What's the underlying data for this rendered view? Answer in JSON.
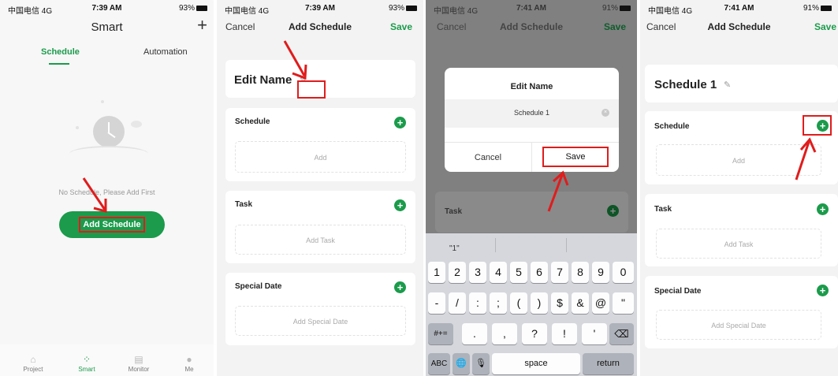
{
  "colors": {
    "brand_green": "#1b9b4b",
    "highlight_red": "#e01c1c"
  },
  "status_bar": {
    "carrier": "中国电信 4G",
    "screen1_time": "7:39 AM",
    "screen1_battery": "93%",
    "screen2_time": "7:39 AM",
    "screen2_battery": "93%",
    "screen3_time": "7:41 AM",
    "screen3_battery": "91%",
    "screen4_time": "7:41 AM",
    "screen4_battery": "91%"
  },
  "screen1": {
    "title": "Smart",
    "add_icon": "plus-icon",
    "tabs": [
      "Schedule",
      "Automation"
    ],
    "empty_message": "No Schedule, Please Add First",
    "add_button": "Add Schedule",
    "bottom_nav": [
      {
        "label": "Project",
        "icon": "home-icon"
      },
      {
        "label": "Smart",
        "icon": "smart-dots-icon"
      },
      {
        "label": "Monitor",
        "icon": "monitor-icon"
      },
      {
        "label": "Me",
        "icon": "person-icon"
      }
    ]
  },
  "screen2": {
    "cancel": "Cancel",
    "title": "Add Schedule",
    "save": "Save",
    "name": "Edit Name",
    "sections": [
      {
        "title": "Schedule",
        "placeholder": "Add"
      },
      {
        "title": "Task",
        "placeholder": "Add Task"
      },
      {
        "title": "Special Date",
        "placeholder": "Add Special Date"
      }
    ]
  },
  "screen3": {
    "cancel": "Cancel",
    "title": "Add Schedule",
    "save": "Save",
    "dialog": {
      "title": "Edit Name",
      "input_value": "Schedule 1",
      "cancel": "Cancel",
      "save": "Save"
    },
    "behind_section": "Task",
    "keyboard": {
      "suggestion": "\"1\"",
      "row1": [
        "1",
        "2",
        "3",
        "4",
        "5",
        "6",
        "7",
        "8",
        "9",
        "0"
      ],
      "row2": [
        "-",
        "/",
        ":",
        ";",
        "(",
        ")",
        "$",
        "&",
        "@",
        "\""
      ],
      "row3_left": "#+=",
      "row3": [
        ".",
        ",",
        "?",
        "!",
        "'"
      ],
      "row3_right": "⌫",
      "abc": "ABC",
      "globe": "🌐",
      "mic": "🎙",
      "space": "space",
      "return": "return"
    }
  },
  "screen4": {
    "cancel": "Cancel",
    "title": "Add Schedule",
    "save": "Save",
    "name": "Schedule 1",
    "sections": [
      {
        "title": "Schedule",
        "placeholder": "Add"
      },
      {
        "title": "Task",
        "placeholder": "Add Task"
      },
      {
        "title": "Special Date",
        "placeholder": "Add Special Date"
      }
    ]
  }
}
